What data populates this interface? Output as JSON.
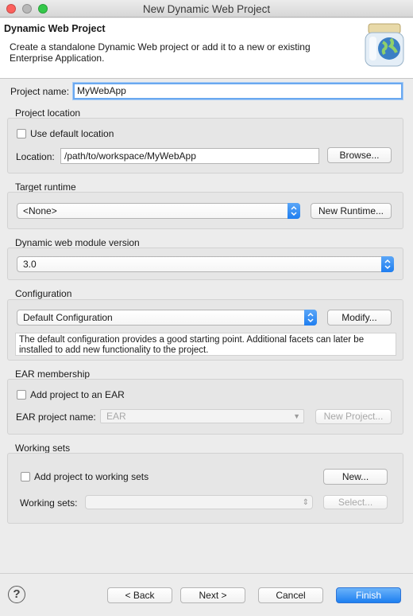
{
  "window": {
    "title": "New Dynamic Web Project"
  },
  "header": {
    "title": "Dynamic Web Project",
    "description": "Create a standalone Dynamic Web project or add it to a new or existing Enterprise Application."
  },
  "project_name": {
    "label": "Project name:",
    "value": "MyWebApp"
  },
  "project_location": {
    "title": "Project location",
    "use_default_label": "Use default location",
    "location_label": "Location:",
    "location_value": "/path/to/workspace/MyWebApp",
    "browse_label": "Browse..."
  },
  "target_runtime": {
    "title": "Target runtime",
    "selected": "<None>",
    "new_runtime_label": "New Runtime..."
  },
  "module_version": {
    "title": "Dynamic web module version",
    "selected": "3.0"
  },
  "configuration": {
    "title": "Configuration",
    "selected": "Default Configuration",
    "modify_label": "Modify...",
    "description": "The default configuration provides a good starting point. Additional facets can later be installed to add new functionality to the project."
  },
  "ear": {
    "title": "EAR membership",
    "add_label": "Add project to an EAR",
    "project_name_label": "EAR project name:",
    "project_name_value": "EAR",
    "new_project_label": "New Project..."
  },
  "working_sets": {
    "title": "Working sets",
    "add_label": "Add project to working sets",
    "new_label": "New...",
    "sets_label": "Working sets:",
    "select_label": "Select..."
  },
  "footer": {
    "help_symbol": "?",
    "back_label": "< Back",
    "next_label": "Next >",
    "cancel_label": "Cancel",
    "finish_label": "Finish"
  }
}
